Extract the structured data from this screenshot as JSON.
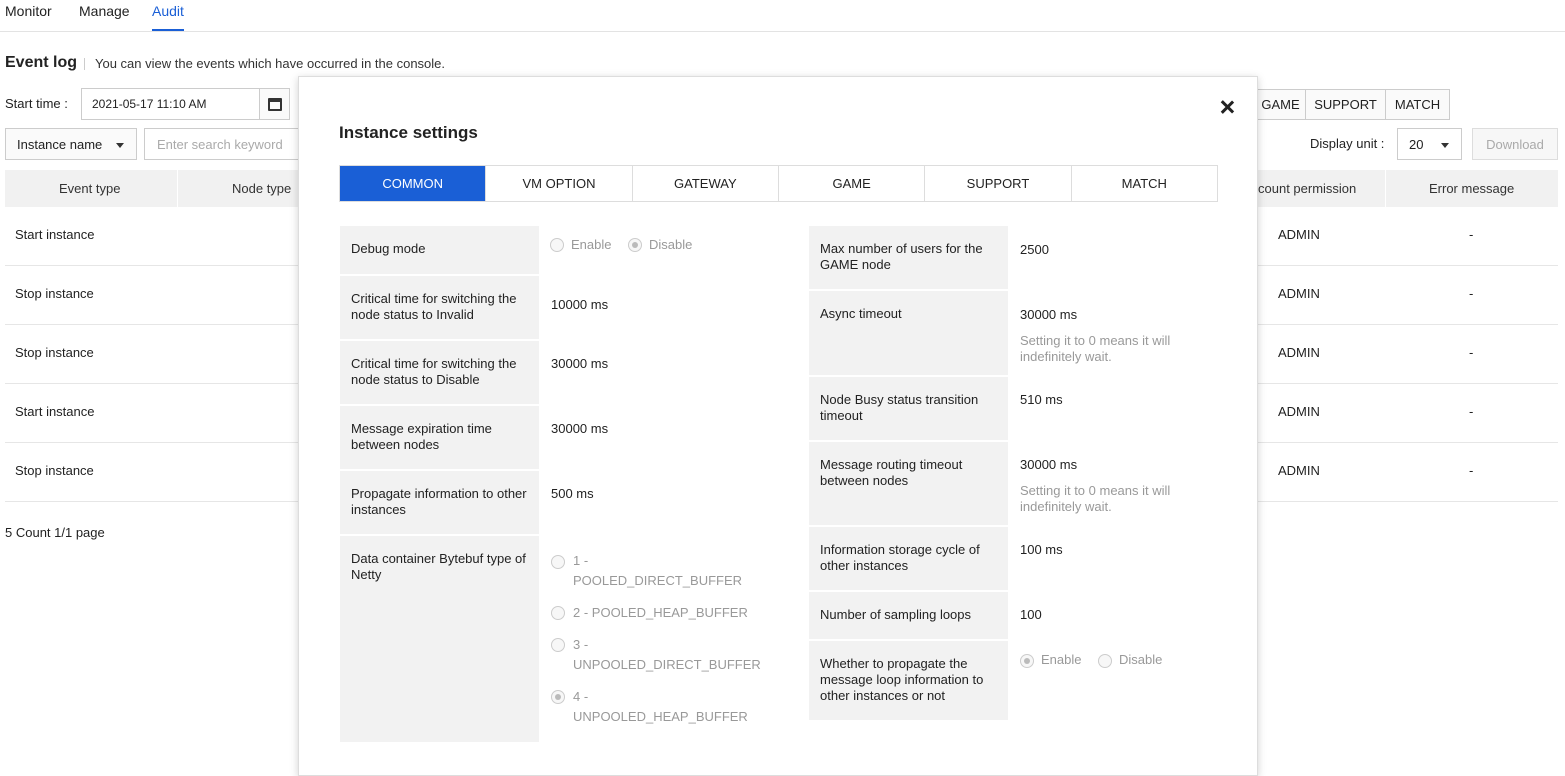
{
  "nav": {
    "tabs": [
      "Monitor",
      "Manage",
      "Audit"
    ],
    "active": "Audit"
  },
  "event_log": {
    "title": "Event log",
    "description": "You can view the events which have occurred in the console."
  },
  "filters": {
    "start_label": "Start time :",
    "start_value": "2021-05-17 11:10 AM",
    "node_buttons": [
      "GAME",
      "SUPPORT",
      "MATCH"
    ],
    "search_field": "Instance name",
    "search_placeholder": "Enter search keyword",
    "display_label": "Display unit :",
    "display_value": "20",
    "download_label": "Download"
  },
  "table": {
    "headers": {
      "event_type": "Event type",
      "node_type": "Node type",
      "account_permission": "count permission",
      "error_message": "Error message"
    },
    "rows": [
      {
        "event": "Start instance",
        "permission": "ADMIN",
        "error": "-"
      },
      {
        "event": "Stop instance",
        "permission": "ADMIN",
        "error": "-"
      },
      {
        "event": "Stop instance",
        "permission": "ADMIN",
        "error": "-"
      },
      {
        "event": "Start instance",
        "permission": "ADMIN",
        "error": "-"
      },
      {
        "event": "Stop instance",
        "permission": "ADMIN",
        "error": "-"
      }
    ],
    "count_text": "5 Count 1/1 page"
  },
  "modal": {
    "title": "Instance settings",
    "tabs": [
      "COMMON",
      "VM OPTION",
      "GATEWAY",
      "GAME",
      "SUPPORT",
      "MATCH"
    ],
    "active_tab": "COMMON",
    "left": {
      "debug_mode": {
        "label": "Debug mode",
        "options": [
          "Enable",
          "Disable"
        ],
        "selected": "Disable"
      },
      "invalid_time": {
        "label": "Critical time for switching the node status to Invalid",
        "value": "10000 ms"
      },
      "disable_time": {
        "label": "Critical time for switching the node status to Disable",
        "value": "30000 ms"
      },
      "msg_expiration": {
        "label": "Message expiration time between nodes",
        "value": "30000 ms"
      },
      "propagate_info": {
        "label": "Propagate information to other instances",
        "value": "500 ms"
      },
      "bytebuf": {
        "label": "Data container Bytebuf type of Netty",
        "options": [
          "1 - POOLED_DIRECT_BUFFER",
          "2 - POOLED_HEAP_BUFFER",
          "3 - UNPOOLED_DIRECT_BUFFER",
          "4 - UNPOOLED_HEAP_BUFFER"
        ],
        "selected": "4 - UNPOOLED_HEAP_BUFFER"
      }
    },
    "right": {
      "max_users": {
        "label": "Max number of users for the GAME node",
        "value": "2500"
      },
      "async_timeout": {
        "label": "Async timeout",
        "value": "30000 ms",
        "hint": "Setting it to 0 means it will indefinitely wait."
      },
      "busy_transition": {
        "label": "Node Busy status transition timeout",
        "value": "510 ms"
      },
      "routing_timeout": {
        "label": "Message routing timeout between nodes",
        "value": "30000 ms",
        "hint": "Setting it to 0 means it will indefinitely wait."
      },
      "storage_cycle": {
        "label": "Information storage cycle of other instances",
        "value": "100 ms"
      },
      "sampling_loops": {
        "label": "Number of sampling loops",
        "value": "100"
      },
      "propagate_loop": {
        "label": "Whether to propagate the message loop information to other instances or not",
        "options": [
          "Enable",
          "Disable"
        ],
        "selected": "Enable"
      }
    }
  },
  "colors": {
    "accent": "#1a5fd6",
    "label_bg": "#f2f2f2",
    "hint": "#999999"
  }
}
